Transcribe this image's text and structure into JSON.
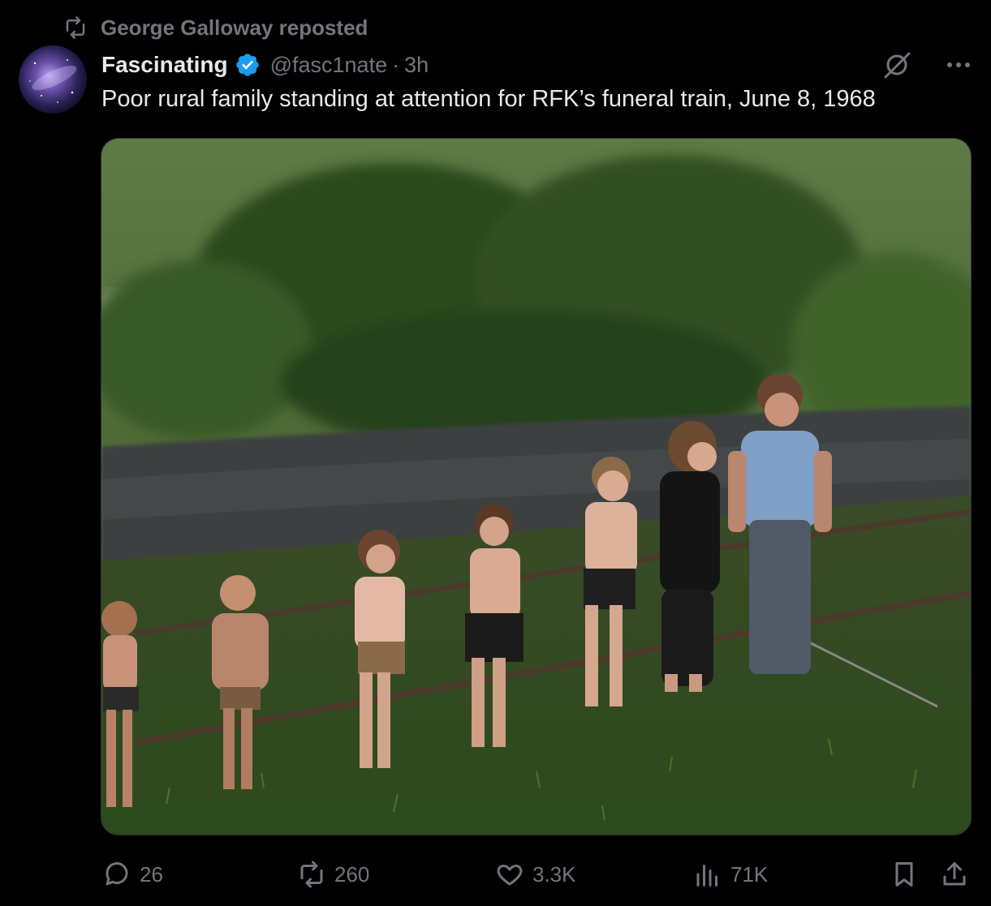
{
  "repost": {
    "text": "George Galloway reposted",
    "icon": "repost-icon"
  },
  "author": {
    "display_name": "Fascinating",
    "handle": "@fasc1nate",
    "separator": "·",
    "time": "3h",
    "verified_color": "#1d9bf0"
  },
  "tweet": {
    "text": "Poor rural family standing at attention for RFK’s funeral train, June 8, 1968"
  },
  "actions": {
    "replies": "26",
    "reposts": "260",
    "likes": "3.3K",
    "views": "71K"
  },
  "colors": {
    "background": "#000000",
    "text_primary": "#e7e9ea",
    "text_secondary": "#71767b",
    "accent": "#1d9bf0"
  }
}
